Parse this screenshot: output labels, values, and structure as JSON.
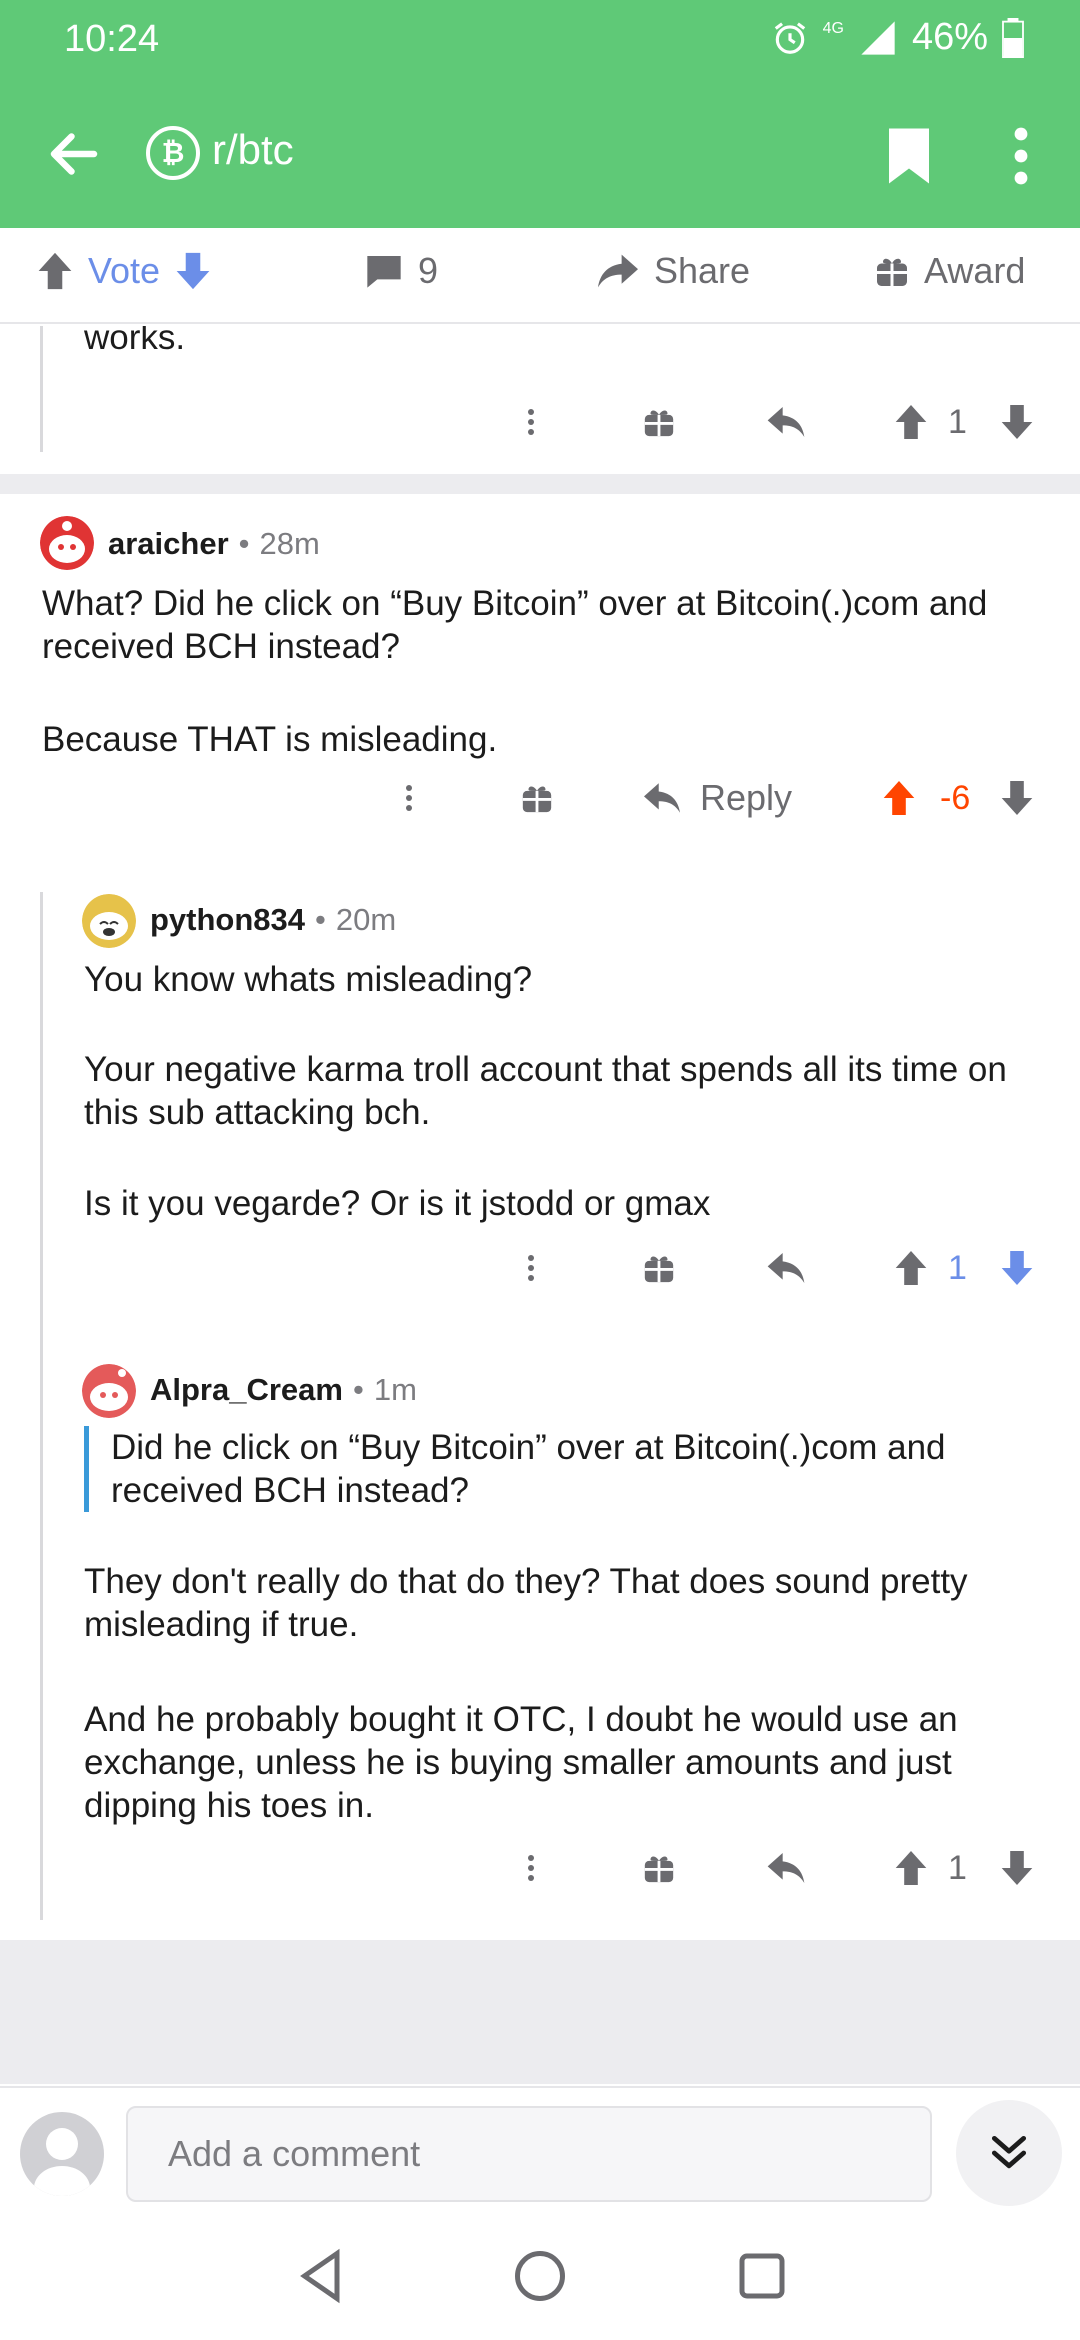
{
  "status_bar": {
    "time": "10:24",
    "network": "4G",
    "battery": "46%"
  },
  "app_bar": {
    "subreddit": "r/btc",
    "sub_icon_glyph": "₿"
  },
  "action_bar": {
    "vote_label": "Vote",
    "comment_count": "9",
    "share_label": "Share",
    "award_label": "Award"
  },
  "comments": [
    {
      "id": "prev",
      "text_tail": "works.",
      "score": "1"
    },
    {
      "id": "araicher",
      "author": "araicher",
      "age": "28m",
      "body_1": "What? Did he click on “Buy Bitcoin” over at Bitcoin(.)com and received BCH instead?",
      "body_2": "Because THAT is misleading.",
      "reply_label": "Reply",
      "score": "-6",
      "vote_state": "upvoted"
    },
    {
      "id": "python834",
      "author": "python834",
      "age": "20m",
      "body_1": "You know whats misleading?",
      "body_2": "Your negative karma troll account that spends all its time on this sub attacking bch.",
      "body_3": "Is it you vegarde? Or is it jstodd or gmax",
      "score": "1",
      "vote_state": "downvoted"
    },
    {
      "id": "alpra",
      "author": "Alpra_Cream",
      "age": "1m",
      "quote": "Did he click on “Buy Bitcoin” over at Bitcoin(.)com and received BCH instead?",
      "body_1": "They don't really do that do they? That does sound pretty misleading if true.",
      "body_2": "And he probably bought it OTC, I doubt he would use an exchange, unless he is buying smaller amounts and just dipping his toes in.",
      "score": "1"
    }
  ],
  "compose": {
    "placeholder": "Add a comment"
  },
  "colors": {
    "brand_green": "#5fc977",
    "upvote_orange": "#ff4500",
    "downvote_blue": "#6b8ee8",
    "quote_bar": "#3a9ad9"
  }
}
